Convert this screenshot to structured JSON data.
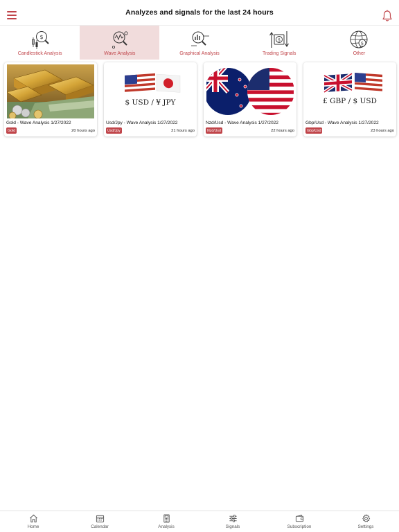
{
  "header": {
    "title": "Analyzes and signals for the last 24 hours"
  },
  "categories": [
    {
      "label": "Candlestick Analysis",
      "icon": "candlestick-magnifier-icon",
      "active": false
    },
    {
      "label": "Wave Analysis",
      "icon": "wave-magnifier-icon",
      "active": true
    },
    {
      "label": "Graphical Analysis",
      "icon": "graph-magnifier-icon",
      "active": false
    },
    {
      "label": "Trading Signals",
      "icon": "trading-signals-icon",
      "active": false
    },
    {
      "label": "Other",
      "icon": "globe-dollar-icon",
      "active": false
    }
  ],
  "cards": [
    {
      "title": "Gold - Wave Analysis 1/27/2022",
      "tag": "Gold",
      "ago": "20 hours ago",
      "image": "gold-bars-image"
    },
    {
      "title": "Usd/Jpy - Wave Analysis 1/27/2022",
      "tag": "Usd/Jpy",
      "ago": "21 hours ago",
      "image": "usd-jpy-flags-image",
      "image_text": "$ USD / ¥ JPY"
    },
    {
      "title": "Nzd/Usd - Wave Analysis 1/27/2022",
      "tag": "Nzd/Usd",
      "ago": "22 hours ago",
      "image": "nzd-usd-flags-image"
    },
    {
      "title": "Gbp/Usd - Wave Analysis 1/27/2022",
      "tag": "Gbp/Usd",
      "ago": "23 hours ago",
      "image": "gbp-usd-flags-image",
      "image_text": "£ GBP / $ USD"
    }
  ],
  "bottom_nav": [
    {
      "label": "Home",
      "icon": "home-icon"
    },
    {
      "label": "Calendar",
      "icon": "calendar-icon"
    },
    {
      "label": "Analysis",
      "icon": "calculator-icon"
    },
    {
      "label": "Signals",
      "icon": "sliders-icon"
    },
    {
      "label": "Subscription",
      "icon": "wallet-icon"
    },
    {
      "label": "Settings",
      "icon": "gear-icon"
    }
  ],
  "colors": {
    "accent": "#c0454a",
    "active_tab_bg": "#f1dcdc"
  }
}
